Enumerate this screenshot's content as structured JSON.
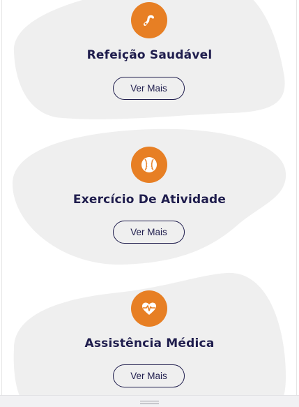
{
  "cards": [
    {
      "title": "Refeição Saudável",
      "button_label": "Ver Mais",
      "icon": "food-icon"
    },
    {
      "title": "Exercício De Atividade",
      "button_label": "Ver Mais",
      "icon": "ball-icon"
    },
    {
      "title": "Assistência Médica",
      "button_label": "Ver Mais",
      "icon": "heart-pulse-icon"
    }
  ],
  "colors": {
    "accent": "#e77f24",
    "text": "#1f1d4d",
    "blob": "#efefef"
  }
}
